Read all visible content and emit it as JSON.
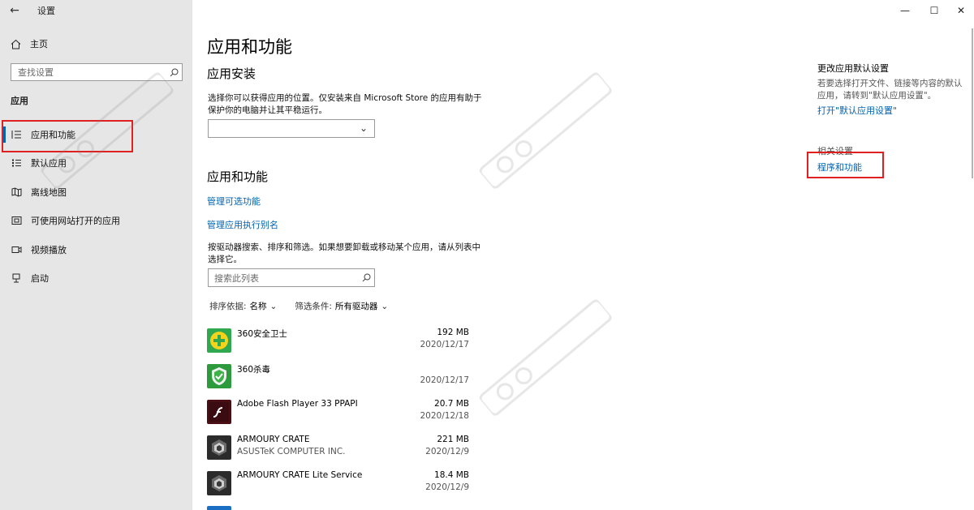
{
  "window": {
    "title": "设置",
    "back_icon": "back-arrow-icon",
    "controls": [
      "minimize-icon",
      "maximize-icon",
      "close-icon"
    ]
  },
  "sidebar": {
    "home_label": "主页",
    "search_placeholder": "查找设置",
    "section": "应用",
    "items": [
      {
        "label": "应用和功能",
        "icon": "apps-features-icon",
        "selected": true
      },
      {
        "label": "默认应用",
        "icon": "default-apps-icon",
        "selected": false
      },
      {
        "label": "离线地图",
        "icon": "offline-maps-icon",
        "selected": false
      },
      {
        "label": "可使用网站打开的应用",
        "icon": "apps-websites-icon",
        "selected": false
      },
      {
        "label": "视频播放",
        "icon": "video-playback-icon",
        "selected": false
      },
      {
        "label": "启动",
        "icon": "startup-icon",
        "selected": false
      }
    ]
  },
  "main": {
    "title": "应用和功能",
    "install": {
      "heading": "应用安装",
      "desc_line1": "选择你可以获得应用的位置。仅安装来自 Microsoft Store 的应用有助于",
      "desc_line2": "保护你的电脑并让其平稳运行。",
      "dropdown_value": ""
    },
    "apps": {
      "heading": "应用和功能",
      "link_optional": "管理可选功能",
      "link_alias": "管理应用执行别名",
      "desc_line1": "按驱动器搜索、排序和筛选。如果想要卸载或移动某个应用，请从列表中",
      "desc_line2": "选择它。",
      "search_placeholder": "搜索此列表",
      "sort_label": "排序依据:",
      "sort_value": "名称",
      "filter_label": "筛选条件:",
      "filter_value": "所有驱动器",
      "list": [
        {
          "name": "360安全卫士",
          "publisher": "",
          "size": "192 MB",
          "date": "2020/12/17",
          "icon": "360-safe-icon",
          "color": "#2fa84f"
        },
        {
          "name": "360杀毒",
          "publisher": "",
          "size": "",
          "date": "2020/12/17",
          "icon": "360-antivirus-icon",
          "color": "#2e9a3e"
        },
        {
          "name": "Adobe Flash Player 33 PPAPI",
          "publisher": "",
          "size": "20.7 MB",
          "date": "2020/12/18",
          "icon": "flash-icon",
          "color": "#4a0f14"
        },
        {
          "name": "ARMOURY CRATE",
          "publisher": "ASUSTeK COMPUTER INC.",
          "size": "221 MB",
          "date": "2020/12/9",
          "icon": "armoury-crate-icon",
          "color": "#2b2b2b"
        },
        {
          "name": "ARMOURY CRATE Lite Service",
          "publisher": "",
          "size": "18.4 MB",
          "date": "2020/12/9",
          "icon": "armoury-crate-lite-icon",
          "color": "#2b2b2b"
        }
      ]
    }
  },
  "right": {
    "default_heading": "更改应用默认设置",
    "default_desc_line1": "若要选择打开文件、链接等内容的默认",
    "default_desc_line2": "应用，请转到\"默认应用设置\"。",
    "default_link": "打开\"默认应用设置\"",
    "related_heading": "相关设置",
    "related_link": "程序和功能"
  },
  "colors": {
    "accent": "#0063b1",
    "sidebar_bg": "#e6e6e6",
    "highlight_box": "#e02020"
  }
}
